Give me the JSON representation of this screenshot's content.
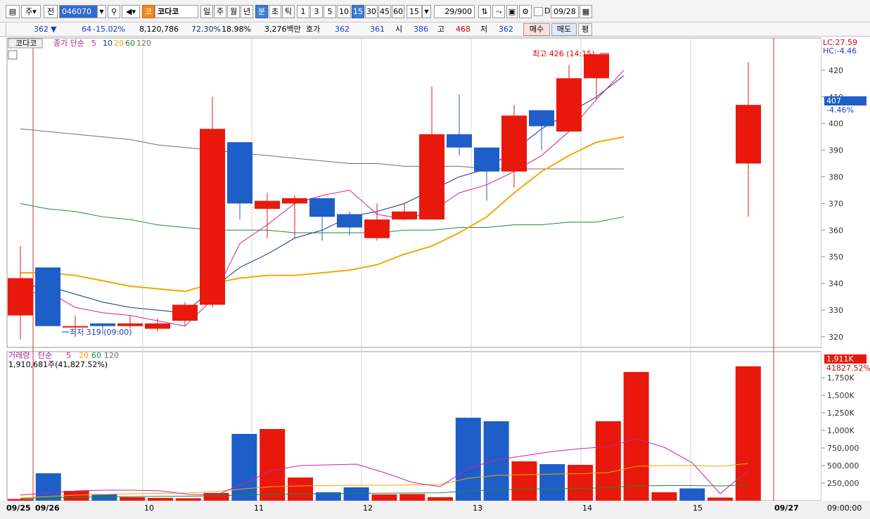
{
  "toolbar": {
    "period_type": "주",
    "mode_label": "전",
    "code": "046070",
    "market_badge": "코",
    "stock_name": "코다코",
    "periods": [
      "일",
      "주",
      "월",
      "년"
    ],
    "interval_units": [
      "분",
      "초",
      "틱"
    ],
    "intervals": [
      "1",
      "3",
      "5",
      "10",
      "15",
      "30",
      "45",
      "60"
    ],
    "interval_selected": "15",
    "interval_dropdown": "15",
    "count_value": "29",
    "count_max": "/900",
    "date_flag": "D",
    "date_value": "09/28"
  },
  "infobar": {
    "price": "362",
    "change_arrow": "▼",
    "change": "64",
    "change_pct": "-15.02%",
    "volume": "8,120,786",
    "vol_ratio": "72.30%",
    "turnover": "18.98%",
    "amount": "3,276백만",
    "ask_label": "호가",
    "ask": "362",
    "bid": "361",
    "open_label": "시",
    "open": "386",
    "high_label": "고",
    "high": "468",
    "low_label": "저",
    "low": "362",
    "buy_label": "매수",
    "sell_label": "매도",
    "avg_label": "평"
  },
  "price_panel": {
    "legend_name": "코다코",
    "legend_ma_label": "종가 단순",
    "legend_ma": [
      "5",
      "10",
      "20",
      "60",
      "120"
    ],
    "max_label": "최고 426 (14:15)",
    "min_label": "최저 319 (09:00)",
    "lc": "LC:27.59",
    "hc": "HC:-4.46",
    "current_price": "407",
    "current_pct": "-4.46%",
    "y_ticks": [
      "420",
      "410",
      "400",
      "390",
      "380",
      "370",
      "360",
      "350",
      "340",
      "330",
      "320"
    ]
  },
  "volume_panel": {
    "legend_name": "거래량",
    "legend_ma_label": "단순",
    "legend_ma": [
      "5",
      "20",
      "60",
      "120"
    ],
    "info": "1,910,681주(41,827.52%)",
    "current_volume": "1,911K",
    "current_pct": "41827.52%",
    "y_ticks": [
      "1,750K",
      "1,500K",
      "1,250K",
      "1,000K",
      "750,000",
      "500,000",
      "250,000"
    ]
  },
  "x_axis": {
    "labels": [
      "09/25",
      "09/26",
      "10",
      "11",
      "12",
      "13",
      "14",
      "15",
      "09/27"
    ],
    "time_label": "09:00:00"
  },
  "colors": {
    "up": "#e8190c",
    "down": "#1e5ec8",
    "ma5": "#d0209f",
    "ma10": "#1c2f8f",
    "ma20": "#f0a800",
    "ma60": "#1a8a3a",
    "ma120": "#7a6a6a"
  },
  "chart_data": {
    "type": "candlestick",
    "candles": [
      {
        "o": 328,
        "h": 354,
        "l": 319,
        "c": 342
      },
      {
        "o": 346,
        "h": 346,
        "l": 324,
        "c": 324
      },
      {
        "o": 324,
        "h": 328,
        "l": 320,
        "c": 324
      },
      {
        "o": 325,
        "h": 325,
        "l": 321,
        "c": 324
      },
      {
        "o": 324,
        "h": 328,
        "l": 323,
        "c": 325
      },
      {
        "o": 323,
        "h": 327,
        "l": 322,
        "c": 325
      },
      {
        "o": 326,
        "h": 333,
        "l": 324,
        "c": 332
      },
      {
        "o": 332,
        "h": 410,
        "l": 331,
        "c": 398
      },
      {
        "o": 393,
        "h": 393,
        "l": 364,
        "c": 370
      },
      {
        "o": 368,
        "h": 374,
        "l": 357,
        "c": 371
      },
      {
        "o": 370,
        "h": 373,
        "l": 357,
        "c": 372
      },
      {
        "o": 372,
        "h": 372,
        "l": 356,
        "c": 365
      },
      {
        "o": 366,
        "h": 367,
        "l": 358,
        "c": 361
      },
      {
        "o": 357,
        "h": 370,
        "l": 356,
        "c": 364
      },
      {
        "o": 364,
        "h": 370,
        "l": 364,
        "c": 367
      },
      {
        "o": 364,
        "h": 414,
        "l": 364,
        "c": 396
      },
      {
        "o": 396,
        "h": 411,
        "l": 388,
        "c": 391
      },
      {
        "o": 391,
        "h": 391,
        "l": 371,
        "c": 382
      },
      {
        "o": 382,
        "h": 407,
        "l": 376,
        "c": 403
      },
      {
        "o": 405,
        "h": 405,
        "l": 390,
        "c": 399
      },
      {
        "o": 397,
        "h": 422,
        "l": 397,
        "c": 417
      },
      {
        "o": 417,
        "h": 426,
        "l": 409,
        "c": 426
      },
      {
        "o": 385,
        "h": 423,
        "l": 365,
        "c": 407
      }
    ],
    "volumes": [
      25,
      390,
      140,
      95,
      50,
      40,
      35,
      110,
      950,
      1020,
      330,
      120,
      190,
      90,
      95,
      50,
      1180,
      1130,
      560,
      520,
      510,
      1130,
      1830,
      120,
      175,
      45,
      1911
    ],
    "ma5": [
      336,
      337,
      331,
      329,
      328,
      326,
      324,
      334,
      355,
      362,
      370,
      373,
      375,
      366,
      364,
      367,
      374,
      377,
      382,
      388,
      397,
      409,
      420,
      426,
      424,
      422,
      412
    ],
    "ma10": [
      339,
      339,
      336,
      333,
      331,
      330,
      329,
      338,
      346,
      351,
      357,
      360,
      365,
      367,
      370,
      375,
      380,
      383,
      390,
      398,
      404,
      410,
      418
    ],
    "ma20": [
      344,
      344,
      343,
      341,
      339,
      338,
      337,
      340,
      342,
      343,
      343,
      344,
      345,
      347,
      351,
      354,
      359,
      365,
      374,
      382,
      388,
      393,
      395
    ],
    "ma60": [
      370,
      368,
      367,
      365,
      364,
      362,
      361,
      360,
      360,
      360,
      359,
      359,
      359,
      359,
      360,
      360,
      361,
      361,
      362,
      362,
      363,
      363,
      365
    ],
    "ma120": [
      398,
      397,
      396,
      395,
      394,
      392,
      391,
      390,
      389,
      388,
      387,
      386,
      385,
      385,
      384,
      384,
      384,
      383,
      383,
      383,
      383,
      383,
      383
    ],
    "vol_ma5": [
      80,
      110,
      140,
      150,
      150,
      140,
      90,
      80,
      250,
      430,
      500,
      510,
      520,
      400,
      260,
      200,
      460,
      580,
      640,
      700,
      740,
      770,
      880,
      760,
      540,
      100,
      430
    ],
    "vol_ma20": [
      40,
      60,
      80,
      90,
      100,
      105,
      110,
      130,
      170,
      200,
      210,
      215,
      220,
      220,
      225,
      230,
      320,
      360,
      370,
      380,
      385,
      400,
      490,
      500,
      500,
      490,
      530
    ],
    "vol_ma60": [
      30,
      40,
      50,
      55,
      60,
      62,
      65,
      70,
      80,
      90,
      95,
      100,
      105,
      108,
      110,
      112,
      140,
      155,
      165,
      170,
      175,
      185,
      210,
      215,
      215,
      210,
      225
    ],
    "ylim": [
      316,
      430
    ],
    "vol_ylim": [
      0,
      2000
    ]
  }
}
